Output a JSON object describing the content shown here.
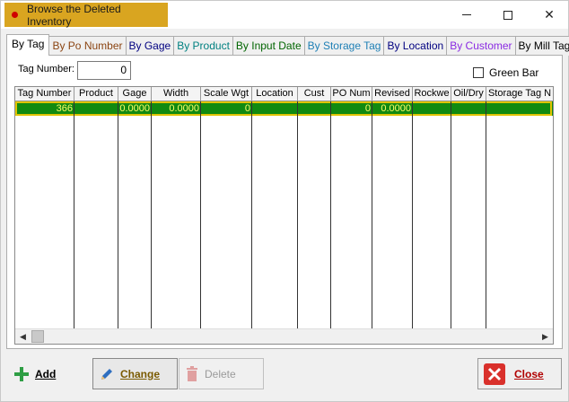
{
  "window": {
    "title": "Browse the Deleted Inventory"
  },
  "tabs": [
    {
      "label": "By Tag",
      "color": "#000000",
      "active": true
    },
    {
      "label": "By Po Number",
      "color": "#8b4513"
    },
    {
      "label": "By Gage",
      "color": "#000080"
    },
    {
      "label": "By Product",
      "color": "#008080"
    },
    {
      "label": "By Input Date",
      "color": "#006400"
    },
    {
      "label": "By Storage Tag",
      "color": "#1e7fb5"
    },
    {
      "label": "By Location",
      "color": "#000080"
    },
    {
      "label": "By Customer",
      "color": "#8a2be2"
    },
    {
      "label": "By Mill Tag No",
      "color": "#000000"
    }
  ],
  "filter": {
    "tag_label": "Tag Number:",
    "tag_value": "0",
    "green_bar_label": "Green Bar",
    "green_bar_checked": false
  },
  "grid": {
    "columns": [
      "Tag Number",
      "Product",
      "Gage",
      "Width",
      "Scale Wgt",
      "Location",
      "Cust",
      "PO Num",
      "Revised",
      "Rockwe",
      "Oil/Dry",
      "Storage Tag N"
    ],
    "rows": [
      [
        "366",
        "",
        "0.0000",
        "0.0000",
        "0",
        "",
        "",
        "0",
        "0.0000",
        "",
        "",
        ""
      ]
    ],
    "selected_row_color": "#118a11",
    "selected_text_color": "#ffff66"
  },
  "buttons": {
    "add": "Add",
    "change": "Change",
    "delete": "Delete",
    "close": "Close"
  }
}
